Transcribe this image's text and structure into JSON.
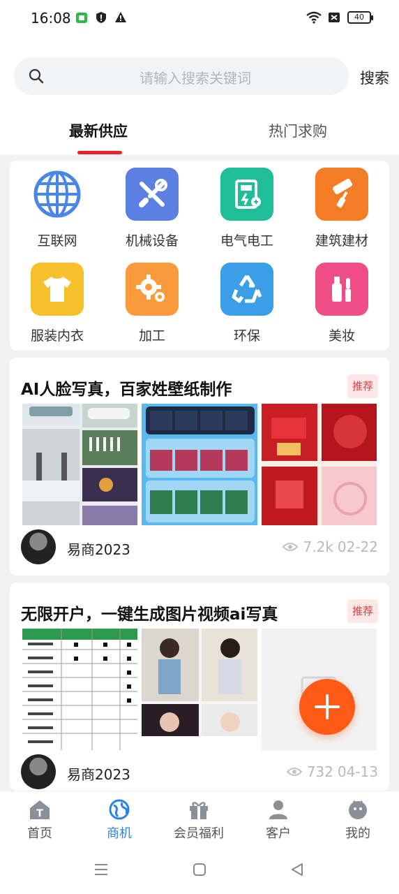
{
  "status_bar": {
    "time": "16:08",
    "battery": "40"
  },
  "search": {
    "placeholder": "请输入搜索关键词",
    "button": "搜索"
  },
  "tabs": [
    {
      "label": "最新供应"
    },
    {
      "label": "热门求购"
    }
  ],
  "categories": [
    {
      "label": "互联网",
      "icon": "globe-icon",
      "color": "#ffffff"
    },
    {
      "label": "机械设备",
      "icon": "tools-icon",
      "color": "#5b7fe3"
    },
    {
      "label": "电气电工",
      "icon": "electric-meter-icon",
      "color": "#1fbe98"
    },
    {
      "label": "建筑建材",
      "icon": "paint-roller-icon",
      "color": "#f47c24"
    },
    {
      "label": "服装内衣",
      "icon": "tshirt-icon",
      "color": "#f5c02c"
    },
    {
      "label": "加工",
      "icon": "gears-icon",
      "color": "#fb9a3c"
    },
    {
      "label": "环保",
      "icon": "recycle-icon",
      "color": "#3a9fe6"
    },
    {
      "label": "美妆",
      "icon": "cosmetics-icon",
      "color": "#ee4d86"
    }
  ],
  "posts": [
    {
      "title": "AI人脸写真，百家姓壁纸制作",
      "badge": "推荐",
      "author": "易商2023",
      "views": "7.2k",
      "date": "02-22"
    },
    {
      "title": "无限开户，一键生成图片视频ai写真",
      "badge": "推荐",
      "author": "易商2023",
      "views": "732",
      "date": "04-13"
    }
  ],
  "bottom_nav": [
    {
      "label": "首页",
      "icon": "home-icon"
    },
    {
      "label": "商机",
      "icon": "globe-icon",
      "active": true
    },
    {
      "label": "会员福利",
      "icon": "gift-icon"
    },
    {
      "label": "客户",
      "icon": "user-icon"
    },
    {
      "label": "我的",
      "icon": "profile-icon"
    }
  ],
  "colors": {
    "accent": "#e8212b",
    "active_nav": "#2a82e4",
    "fab": "#ff5a17"
  }
}
